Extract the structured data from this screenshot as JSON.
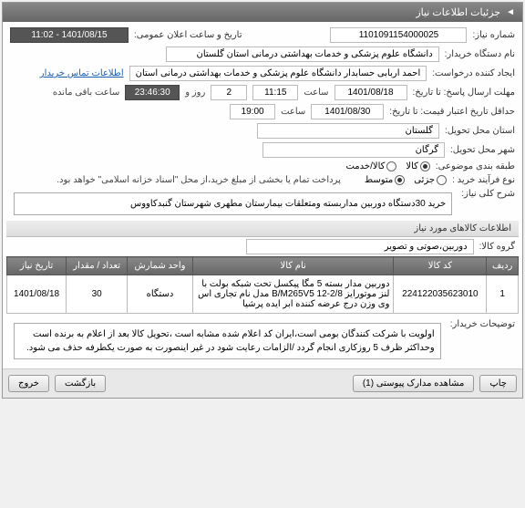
{
  "panel": {
    "title": "جزئیات اطلاعات نیاز"
  },
  "need": {
    "number_label": "شماره نیاز:",
    "number": "1101091154000025",
    "announce_label": "تاریخ و ساعت اعلان عمومی:",
    "announce_value": "1401/08/15 - 11:02",
    "buyer_label": "نام دستگاه خریدار:",
    "buyer": "دانشگاه علوم پزشکی و خدمات بهداشتی درمانی استان گلستان",
    "requester_label": "ایجاد کننده درخواست:",
    "requester": "احمد اربابی حسابدار دانشگاه علوم پزشکی و خدمات بهداشتی درمانی استان",
    "contact_link": "اطلاعات تماس خریدار",
    "deadline_label": "مهلت ارسال پاسخ: تا تاریخ:",
    "deadline_date": "1401/08/18",
    "time_label": "ساعت",
    "deadline_time": "11:15",
    "remaining_days": "2",
    "remaining_day_label": "روز و",
    "remaining_time": "23:46:30",
    "remaining_suffix": "ساعت باقی مانده",
    "validity_label": "حداقل تاریخ اعتبار قیمت: تا تاریخ:",
    "validity_date": "1401/08/30",
    "validity_time": "19:00",
    "province_label": "استان محل تحویل:",
    "province": "گلستان",
    "city_label": "شهر محل تحویل:",
    "city": "گرگان",
    "class_label": "طبقه بندی موضوعی:",
    "class_goods": "کالا",
    "class_service": "کالا/خدمت",
    "process_label": "نوع فرآیند خرید :",
    "process_small": "جزئی",
    "process_medium": "متوسط",
    "process_note": "پرداخت تمام یا بخشی از مبلغ خرید،از محل \"اسناد خزانه اسلامی\" خواهد بود."
  },
  "desc": {
    "label": "شرح کلی نیاز:",
    "text": "خرید 30دستگاه دوربین مداربسته ومتعلقات بیمارستان مطهری شهرستان گنبدکاووس"
  },
  "goods": {
    "header": "اطلاعات کالاهای مورد نیاز",
    "group_label": "گروه کالا:",
    "group_value": "دوربین،صوتی و تصویر"
  },
  "table": {
    "cols": {
      "row": "ردیف",
      "code": "کد کالا",
      "name": "نام کالا",
      "unit": "واحد شمارش",
      "qty": "تعداد / مقدار",
      "date": "تاریخ نیاز"
    },
    "rows": [
      {
        "row": "1",
        "code": "224122035623010",
        "name": "دوربین مدار بسته 5 مگا پیکسل تحت شبکه بولت با لنز موتورایز B/M265V5 12-2/8 مدل نام تجاری اس وی وزن درج عرضه کننده ابر ایده پرشیا",
        "unit": "دستگاه",
        "qty": "30",
        "date": "1401/08/18"
      }
    ]
  },
  "notes": {
    "label": "توضیحات خریدار:",
    "text": "اولویت با شرکت کنندگان بومی است،ایران کد اعلام شده مشابه است ،تحویل کالا بعد از اعلام به برنده است وحداکثر ظرف 5 روزکاری انجام گردد /الزامات رعایت شود در غیر اینصورت به صورت یکطرفه حذف می شود."
  },
  "buttons": {
    "print": "چاپ",
    "attachments": "مشاهده مدارک پیوستی (1)",
    "back": "بازگشت",
    "exit": "خروج"
  }
}
